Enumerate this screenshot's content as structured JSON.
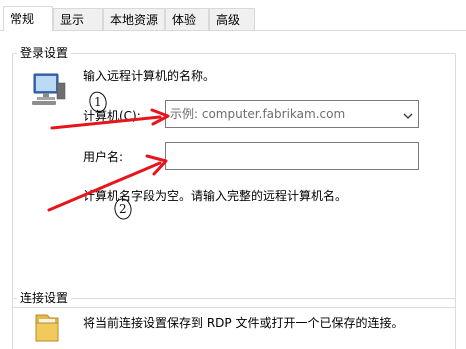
{
  "tabs": [
    {
      "label": "常规",
      "active": true
    },
    {
      "label": "显示",
      "active": false
    },
    {
      "label": "本地资源",
      "active": false
    },
    {
      "label": "体验",
      "active": false
    },
    {
      "label": "高级",
      "active": false
    }
  ],
  "login_group": {
    "title": "登录设置",
    "instruction": "输入远程计算机的名称。",
    "computer_label": "计算机(C):",
    "computer_placeholder": "示例: computer.fabrikam.com",
    "username_label": "用户名:",
    "username_value": "",
    "error_text": "计算机名字段为空。请输入完整的远程计算机名。"
  },
  "connection_group": {
    "title": "连接设置",
    "description": "将当前连接设置保存到 RDP 文件或打开一个已保存的连接。"
  },
  "annotations": {
    "mark_1": "1",
    "mark_2": "2",
    "arrow_color": "#e8141c"
  },
  "icons": {
    "computer": "computer-monitor-icon",
    "folder": "folder-icon",
    "dropdown": "chevron-down-icon"
  }
}
